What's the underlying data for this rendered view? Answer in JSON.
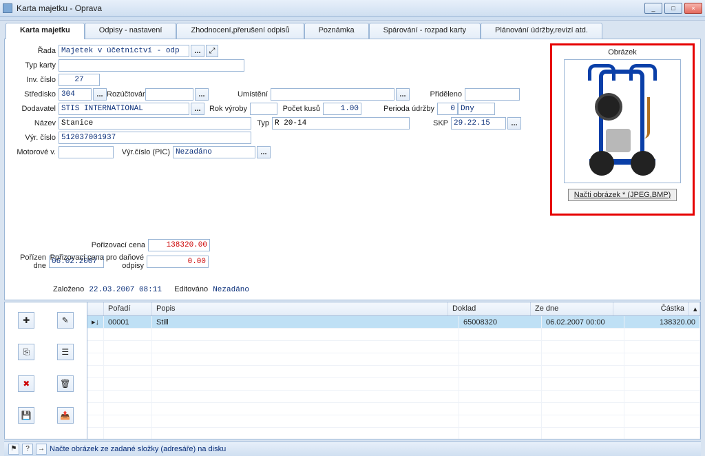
{
  "window": {
    "title": "Karta majetku  - Oprava",
    "min": "_",
    "max": "□",
    "close": "×"
  },
  "tabs": [
    {
      "label": "Karta majetku"
    },
    {
      "label": "Odpisy - nastavení"
    },
    {
      "label": "Zhodnocení,přerušení odpisů"
    },
    {
      "label": "Poznámka"
    },
    {
      "label": "Spárování - rozpad karty"
    },
    {
      "label": "Plánování údržby,revizí atd."
    }
  ],
  "labels": {
    "rada": "Řada",
    "typkarty": "Typ karty",
    "invcislo": "Inv. číslo",
    "stredisko": "Středisko",
    "rozuctovani": "Rozúčtování",
    "umisteni": "Umístění",
    "prideleno": "Přiděleno",
    "dodavatel": "Dodavatel",
    "rokvyroby": "Rok výroby",
    "pocetkusu": "Počet kusů",
    "periodaudrzby": "Perioda údržby",
    "nazev": "Název",
    "typ": "Typ",
    "skp": "SKP",
    "vyrcislo": "Výr. číslo",
    "motorove": "Motorové v.",
    "vyrcislopic": "Výr.číslo (PIC)",
    "porizovaci": "Pořizovací cena",
    "porizenDne": "Pořízen dne",
    "porizovaciDanove": "Pořizovací cena pro daňové odpisy",
    "zalozeno": "Založeno",
    "editovano": "Editováno",
    "obrazek": "Obrázek",
    "nactiObrazek": "Načti obrázek  *  (JPEG,BMP)",
    "ellipsis": "..."
  },
  "values": {
    "rada": "Majetek v účetnictví - odp",
    "typkarty": "",
    "invcislo": "27",
    "stredisko": "304",
    "rozuctovani": "",
    "umisteni": "",
    "prideleno": "",
    "dodavatel": "STIS INTERNATIONAL",
    "rokvyroby": "",
    "pocetkusu": "1.00",
    "periodaudrzby": "0",
    "periodaudrzbyUnit": "Dny",
    "nazev": "Stanice",
    "typ": "R 20-14",
    "skp": "29.22.15",
    "vyrcislo": "512037001937",
    "motorove": "",
    "vyrcislopic": "Nezadáno",
    "porizovaci": "138320.00",
    "porizenDne": "06.02.2007",
    "porizovaciDanove": "0.00",
    "zalozeno": "22.03.2007 08:11",
    "editovano": "Nezadáno"
  },
  "grid": {
    "headers": {
      "poradi": "Pořadí",
      "popis": "Popis",
      "doklad": "Doklad",
      "zedne": "Ze dne",
      "castka": "Částka"
    },
    "indicator": "▸",
    "download": "↓",
    "rows": [
      {
        "poradi": "00001",
        "popis": "Still",
        "doklad": "65008320",
        "zedne": "06.02.2007 00:00",
        "castka": "138320.00"
      }
    ]
  },
  "toolbar_icons": {
    "new": "✚",
    "edit": "✎",
    "copy": "⎘",
    "props": "☰",
    "delete": "✖",
    "deleteAll": "🗑",
    "save": "💾",
    "export": "📤"
  },
  "status": {
    "text": "Načte obrázek ze zadané složky (adresáře) na disku",
    "helpIcon": "?",
    "arrowIcon": "→",
    "flagIcon": "⚑"
  }
}
